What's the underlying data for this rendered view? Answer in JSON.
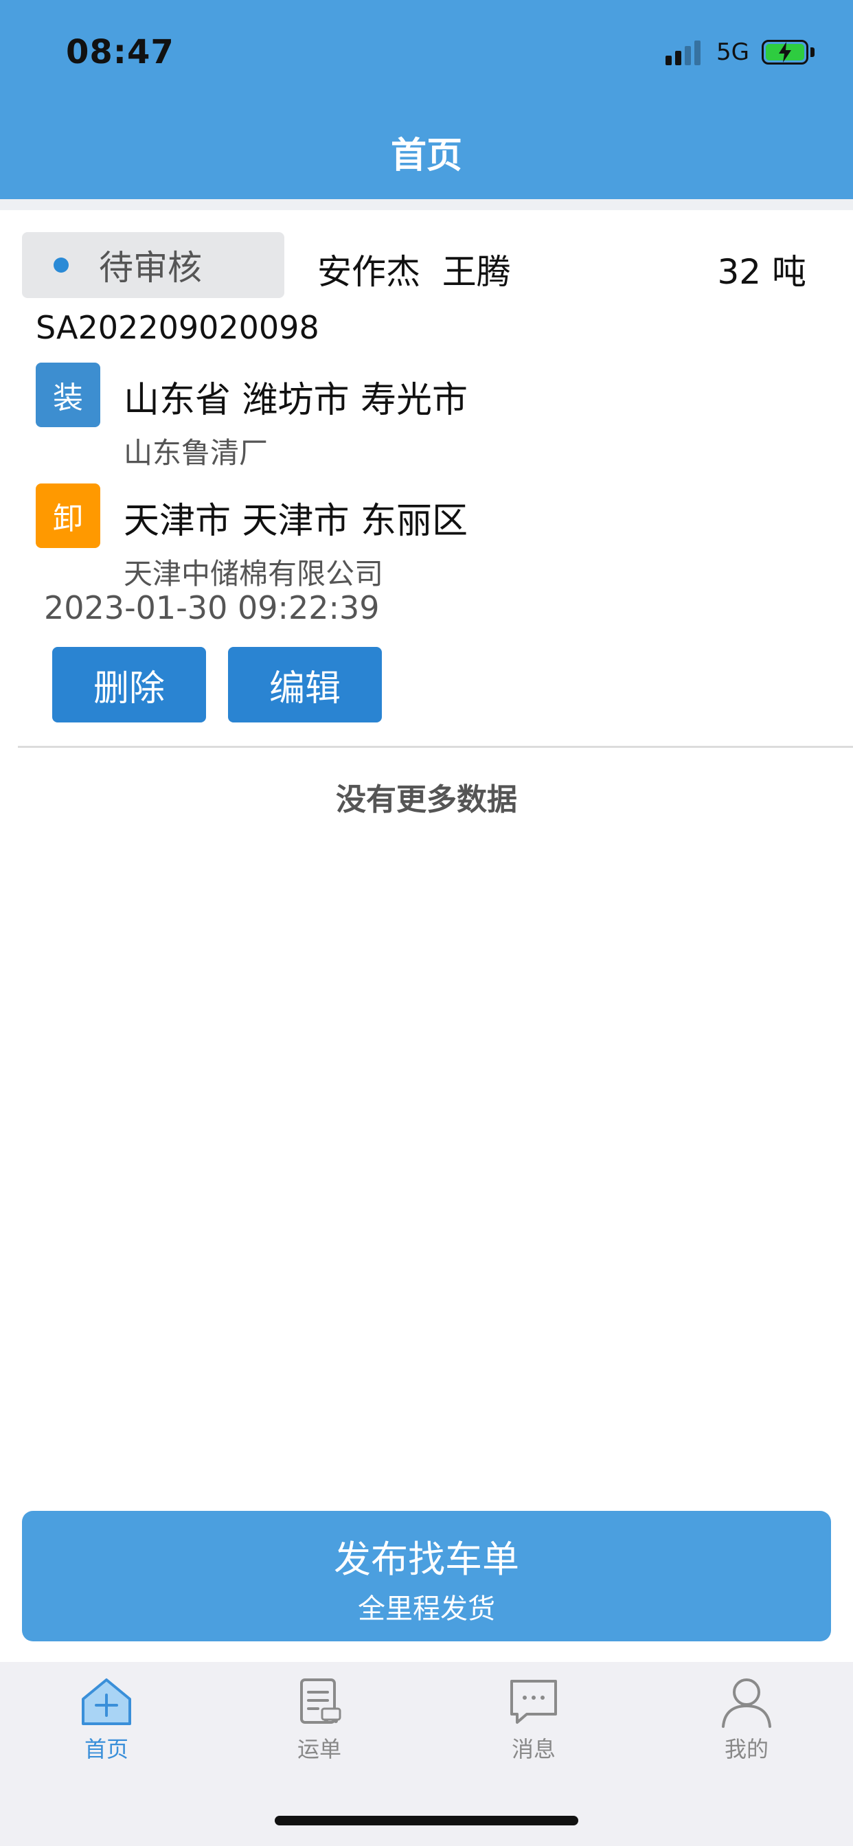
{
  "status_bar": {
    "time": "08:47",
    "network": "5G"
  },
  "header": {
    "title": "首页"
  },
  "order": {
    "status": "待审核",
    "people": [
      "安作杰",
      "王腾"
    ],
    "weight": "32 吨",
    "order_no": "SA202209020098",
    "load": {
      "badge": "装",
      "city": "山东省 潍坊市 寿光市",
      "company": "山东鲁清厂"
    },
    "unload": {
      "badge": "卸",
      "city": "天津市 天津市 东丽区",
      "company": "天津中储棉有限公司"
    },
    "timestamp": "2023-01-30 09:22:39",
    "actions": {
      "delete_label": "删除",
      "edit_label": "编辑"
    }
  },
  "list": {
    "no_more": "没有更多数据"
  },
  "publish": {
    "title": "发布找车单",
    "subtitle": "全里程发货"
  },
  "tabbar": {
    "items": [
      {
        "label": "首页",
        "icon": "home-add-icon",
        "active": true
      },
      {
        "label": "运单",
        "icon": "waybill-icon",
        "active": false
      },
      {
        "label": "消息",
        "icon": "message-icon",
        "active": false
      },
      {
        "label": "我的",
        "icon": "user-icon",
        "active": false
      }
    ]
  },
  "colors": {
    "primary": "#4b9fdf",
    "button": "#2a84d2",
    "load_badge": "#3d8ed0",
    "unload_badge": "#ff9900",
    "status_dot": "#2a8ad6",
    "battery": "#2ecc40"
  }
}
